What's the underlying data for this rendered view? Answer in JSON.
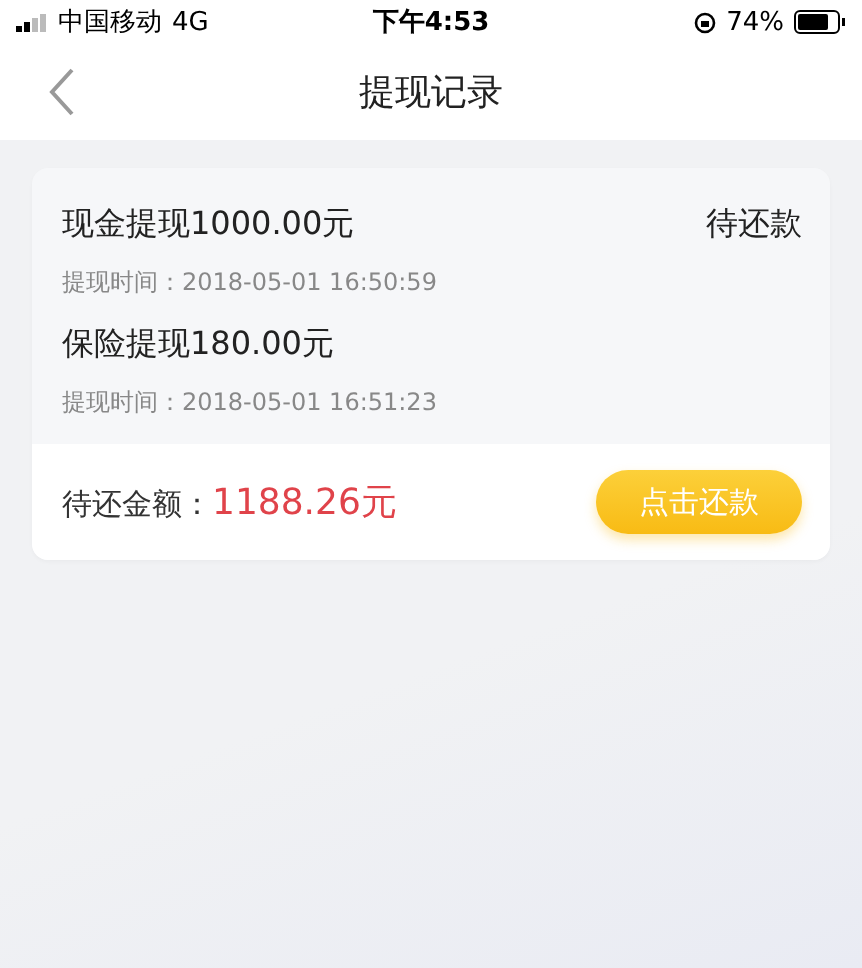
{
  "status_bar": {
    "carrier": "中国移动",
    "network": "4G",
    "time": "下午4:53",
    "battery": "74%"
  },
  "nav": {
    "title": "提现记录"
  },
  "records": [
    {
      "title": "现金提现1000.00元",
      "time": "提现时间：2018-05-01 16:50:59",
      "status": "待还款"
    },
    {
      "title": "保险提现180.00元",
      "time": "提现时间：2018-05-01 16:51:23"
    }
  ],
  "footer": {
    "label": "待还金额：",
    "amount": "1188.26元",
    "button": "点击还款"
  }
}
